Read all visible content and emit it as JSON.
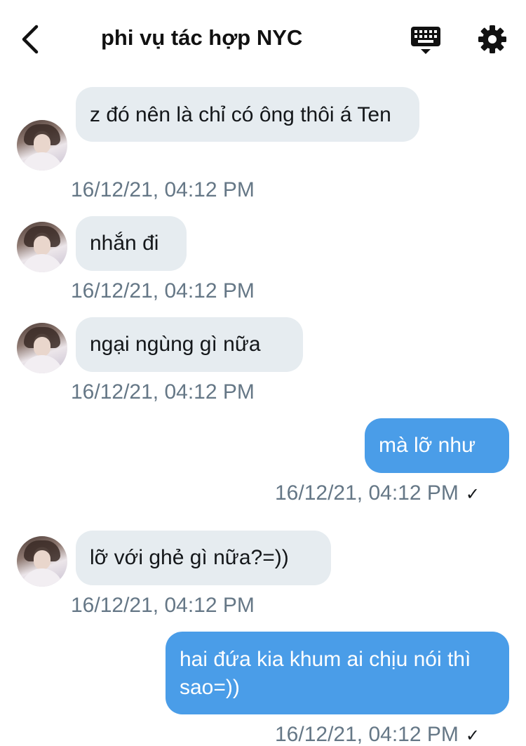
{
  "header": {
    "title": "phi vụ tác hợp NYC"
  },
  "messages": [
    {
      "direction": "in",
      "text": "z đó nên là chỉ có ông thôi á Ten",
      "time": "16/12/21, 04:12 PM"
    },
    {
      "direction": "in",
      "text": "nhắn đi",
      "time": "16/12/21, 04:12 PM"
    },
    {
      "direction": "in",
      "text": "ngại ngùng gì nữa",
      "time": "16/12/21, 04:12 PM"
    },
    {
      "direction": "out",
      "text": "mà lỡ như",
      "time": "16/12/21, 04:12 PM",
      "status": "✓"
    },
    {
      "direction": "in",
      "text": "lỡ với ghẻ gì nữa?=))",
      "time": "16/12/21, 04:12 PM"
    },
    {
      "direction": "out",
      "text": "hai đứa kia khum ai chịu nói thì sao=))",
      "time": "16/12/21, 04:12 PM",
      "status": "✓"
    }
  ],
  "colors": {
    "incoming_bubble": "#e6ecf0",
    "outgoing_bubble": "#4a9de8",
    "timestamp": "#657786"
  },
  "icons": [
    "back-arrow-icon",
    "keyboard-icon",
    "gear-icon"
  ]
}
